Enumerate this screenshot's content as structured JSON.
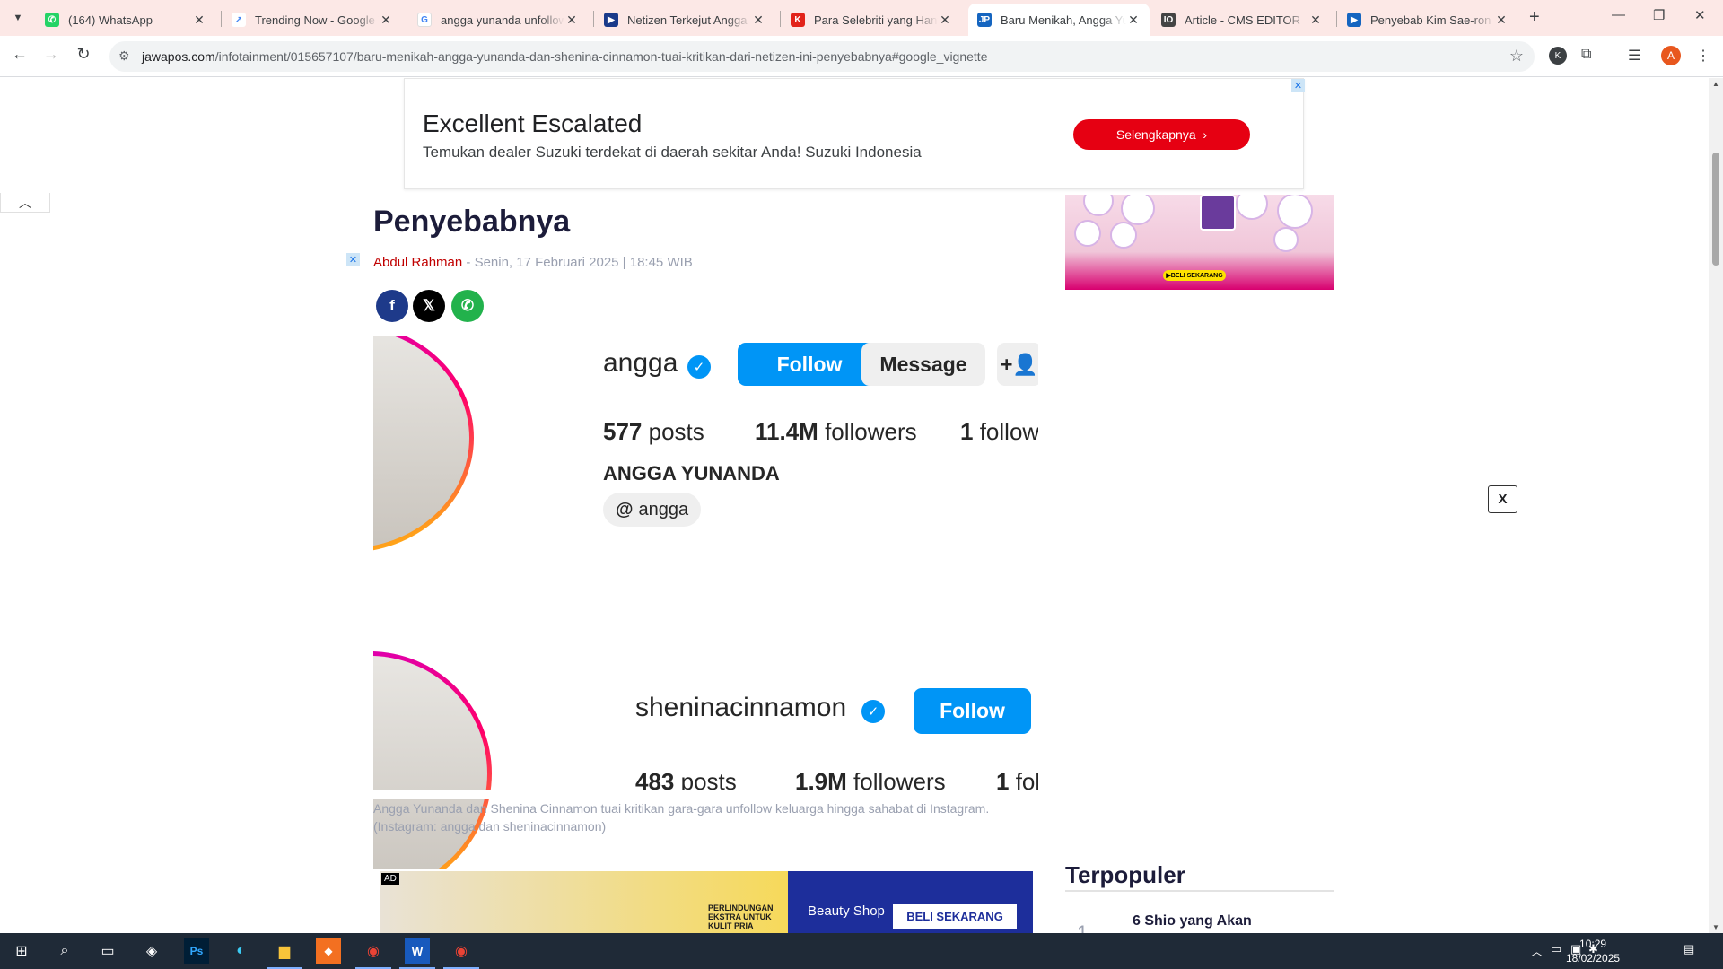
{
  "browser": {
    "tabs": [
      {
        "title": "(164) WhatsApp",
        "favicon_color": "#25d366",
        "favicon": "whatsapp-icon"
      },
      {
        "title": "Trending Now - Google Trends",
        "favicon_color": "#4285f4",
        "favicon": "trends-icon"
      },
      {
        "title": "angga yunanda unfollow",
        "favicon_color": "#4285f4",
        "favicon": "google-icon"
      },
      {
        "title": "Netizen Terkejut Angga Yunanda",
        "favicon_color": "#1a3a8a",
        "favicon": "site-icon"
      },
      {
        "title": "Para Selebriti yang Hanya",
        "favicon_color": "#e2231a",
        "favicon": "site-icon"
      },
      {
        "title": "Baru Menikah, Angga Yunanda",
        "favicon_color": "#1565c0",
        "favicon": "jawapos-icon"
      },
      {
        "title": "Article - CMS EDITOR",
        "favicon_color": "#444",
        "favicon": "cms-icon"
      },
      {
        "title": "Penyebab Kim Sae-ron Meninggal",
        "favicon_color": "#1565c0",
        "favicon": "site-icon"
      }
    ],
    "active_tab": 5,
    "url_domain": "jawapos.com",
    "url_path": "/infotainment/015657107/baru-menikah-angga-yunanda-dan-shenina-cinnamon-tuai-kritikan-dari-netizen-ini-penyebabnya#google_vignette",
    "profile_initial": "A",
    "ext_initial": "K"
  },
  "top_ad": {
    "headline": "Excellent Escalated",
    "description": "Temukan dealer Suzuki terdekat di daerah sekitar Anda! Suzuki Indonesia",
    "cta": "Selengkapnya"
  },
  "sidebar_ad": {
    "cta": "BELI SEKARANG"
  },
  "article": {
    "title_tail": "Penyebabnya",
    "author": "Abdul Rahman",
    "date": "- Senin, 17 Februari 2025 | 18:45 WIB",
    "share": [
      "facebook",
      "x",
      "whatsapp"
    ],
    "caption": "Angga Yunanda dan Shenina Cinnamon tuai kritikan gara-gara unfollow keluarga hingga sahabat di Instagram. (Instagram: angga dan sheninacinnamon)"
  },
  "instagram": {
    "profile1": {
      "username": "angga",
      "follow": "Follow",
      "message": "Message",
      "posts_n": "577",
      "posts_l": "posts",
      "followers_n": "11.4M",
      "followers_l": "followers",
      "following_n": "1",
      "following_l": "followi",
      "fullname": "ANGGA YUNANDA",
      "threads": "angga"
    },
    "profile2": {
      "username": "sheninacinnamon",
      "follow": "Follow",
      "posts_n": "483",
      "posts_l": "posts",
      "followers_n": "1.9M",
      "followers_l": "followers",
      "following_n": "1",
      "following_l": "fol"
    }
  },
  "bottom_ad": {
    "tag": "AD",
    "promo": "PERLINDUNGAN EKSTRA UNTUK KULIT PRIA",
    "brand": "Beauty Shop",
    "cta": "BELI SEKARANG"
  },
  "sidebar": {
    "popular_title": "Terpopuler",
    "popular_first": "6 Shio yang Akan",
    "popular_num": "1",
    "close_x": "X"
  },
  "taskbar": {
    "time": "10:29",
    "date": "18/02/2025"
  }
}
